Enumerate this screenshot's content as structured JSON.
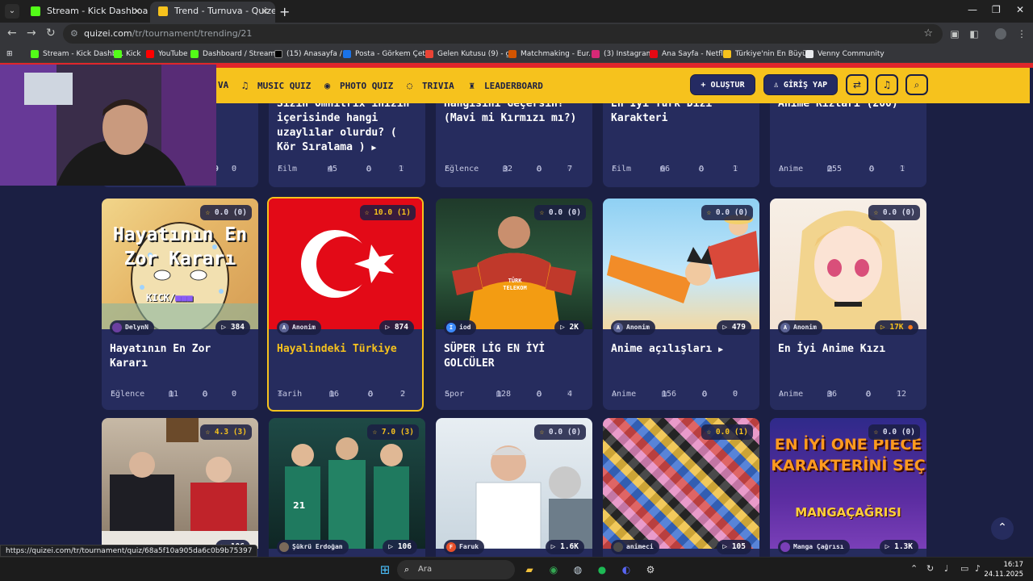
{
  "browser": {
    "tabs": [
      {
        "title": "Stream - Kick Dashboard",
        "active": false
      },
      {
        "title": "Trend - Turnuva - Quizei",
        "active": true
      }
    ],
    "url_host": "quizei.com",
    "url_path": "/tr/tournament/trending/21",
    "bookmarks": [
      "Stream - Kick Dashb...",
      "Kick",
      "YouTube",
      "Dashboard / Stream...",
      "(15) Anasayfa / X",
      "Posta - Görkem Çeti...",
      "Gelen Kutusu (9) - g...",
      "Matchmaking - Eur...",
      "(3) Instagram",
      "Ana Sayfa - Netflix",
      "Türkiye'nin En Büyü...",
      "Venny Community"
    ]
  },
  "sitenav": {
    "items": [
      "VA",
      "MUSIC QUIZ",
      "PHOTO QUIZ",
      "TRIVIA",
      "LEADERBOARD"
    ],
    "create_label": "+ OLUŞTUR",
    "login_label": "GİRİŞ YAP"
  },
  "top_row": [
    {
      "title": "",
      "category": "",
      "count": "",
      "comments": "0",
      "likes": "0",
      "plays_partial": "9"
    },
    {
      "title": "Sizin Omnitrix inizin içerisinde hangi uzaylılar olurdu? ( Kör Sıralama )",
      "category": "Film",
      "count": "45",
      "comments": "0",
      "likes": "1"
    },
    {
      "title": "Hangisini Geçersin? (Mavi mi Kırmızı mı?)",
      "category": "Eğlence",
      "count": "32",
      "comments": "0",
      "likes": "7"
    },
    {
      "title": "En İyi Türk Dizi Karakteri",
      "category": "Film",
      "count": "66",
      "comments": "0",
      "likes": "1"
    },
    {
      "title": "Anime Kızları (200)",
      "category": "Anime",
      "count": "255",
      "comments": "0",
      "likes": "1"
    }
  ],
  "mid_row": [
    {
      "rating": "0.0",
      "votes": "(0)",
      "author": "DelynN",
      "plays": "384",
      "title": "Hayatının En Zor Kararı",
      "category": "Eğlence",
      "count": "11",
      "comments": "0",
      "likes": "0",
      "thumb_text": "Hayatının En Zor Kararı",
      "thumb_sub": "KICK/"
    },
    {
      "rating": "10.0",
      "votes": "(1)",
      "author": "Anonim",
      "plays": "874",
      "title": "Hayalindeki Türkiye",
      "category": "Tarih",
      "count": "16",
      "comments": "0",
      "likes": "2"
    },
    {
      "rating": "0.0",
      "votes": "(0)",
      "author": "iod",
      "plays": "2K",
      "title": "SÜPER LİG EN İYİ GOLCÜLER",
      "category": "Spor",
      "count": "128",
      "comments": "0",
      "likes": "4",
      "thumb_text": "TÜRK TELEKOM"
    },
    {
      "rating": "0.0",
      "votes": "(0)",
      "author": "Anonim",
      "plays": "479",
      "title": "Anime açılışları",
      "category": "Anime",
      "count": "156",
      "comments": "0",
      "likes": "0"
    },
    {
      "rating": "0.0",
      "votes": "(0)",
      "author": "Anonim",
      "plays": "17K",
      "title": "En İyi Anime Kızı",
      "category": "Anime",
      "count": "36",
      "comments": "0",
      "likes": "12"
    }
  ],
  "bottom_row": [
    {
      "rating": "4.3",
      "votes": "(3)",
      "author": "",
      "plays": "106"
    },
    {
      "rating": "7.0",
      "votes": "(3)",
      "author": "Şükrü Erdoğan",
      "plays": "106"
    },
    {
      "rating": "0.0",
      "votes": "(0)",
      "author": "Faruk",
      "plays": "1.6K"
    },
    {
      "rating": "0.0",
      "votes": "(1)",
      "author": "animeci",
      "plays": "105"
    },
    {
      "rating": "0.0",
      "votes": "(0)",
      "author": "Manga Çağrısı",
      "plays": "1.3K",
      "thumb_text": "EN İYİ ONE PIECE KARAKTERİNİ SEÇ",
      "thumb_sub": "MANGAÇAĞRISI"
    }
  ],
  "status_url": "https://quizei.com/tr/tournament/quiz/68a5f10a905da6c0b9b75397",
  "taskbar": {
    "search_placeholder": "Ara",
    "time": "16:17",
    "date": "24.11.2025"
  },
  "colors": {
    "brand_yellow": "#f6c21d",
    "page_bg": "#1b1f43",
    "card_bg": "#262c5e",
    "accent_red": "#e0262b"
  }
}
